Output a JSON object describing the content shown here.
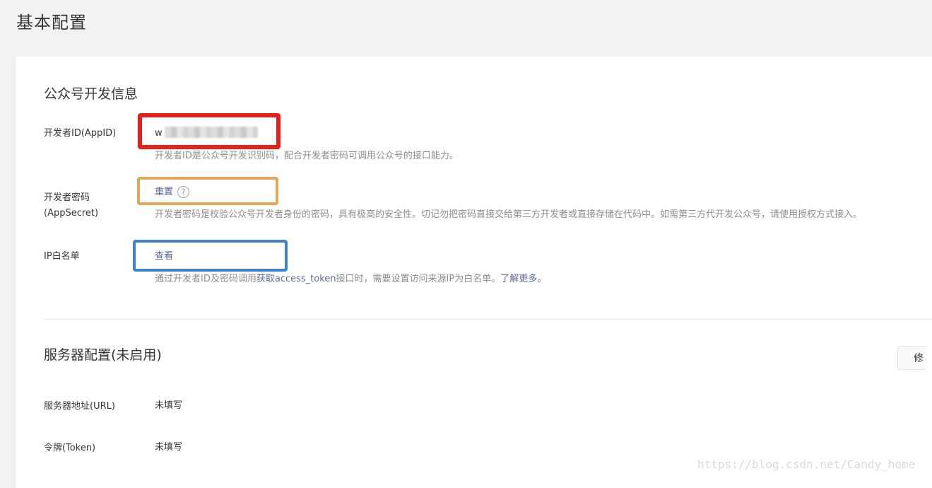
{
  "page": {
    "title": "基本配置"
  },
  "dev_info": {
    "section_title": "公众号开发信息",
    "app_id": {
      "label": "开发者ID(AppID)",
      "value": "w",
      "description": "开发者ID是公众号开发识别码，配合开发者密码可调用公众号的接口能力。"
    },
    "app_secret": {
      "label_line1": "开发者密码",
      "label_line2": "(AppSecret)",
      "action": "重置",
      "help": "?",
      "description": "开发者密码是校验公众号开发者身份的密码，具有极高的安全性。切记勿把密码直接交给第三方开发者或直接存储在代码中。如需第三方代开发公众号，请使用授权方式接入。"
    },
    "ip_whitelist": {
      "label": "IP白名单",
      "action": "查看",
      "description_prefix": "通过开发者ID及密码调用",
      "description_link": "获取access_token",
      "description_middle": "接口时，需要设置访问来源IP为白名单。",
      "learn_more": "了解更多。"
    }
  },
  "server_config": {
    "section_title": "服务器配置(未启用)",
    "side_button": "修",
    "url": {
      "label": "服务器地址(URL)",
      "value": "未填写"
    },
    "token": {
      "label": "令牌(Token)",
      "value": "未填写"
    }
  },
  "annotations": {
    "appid_box_color": "#e8201c",
    "secret_box_color": "#e0a95a",
    "ip_box_color": "#3a84d3"
  },
  "watermark": "https://blog.csdn.net/Candy_home"
}
